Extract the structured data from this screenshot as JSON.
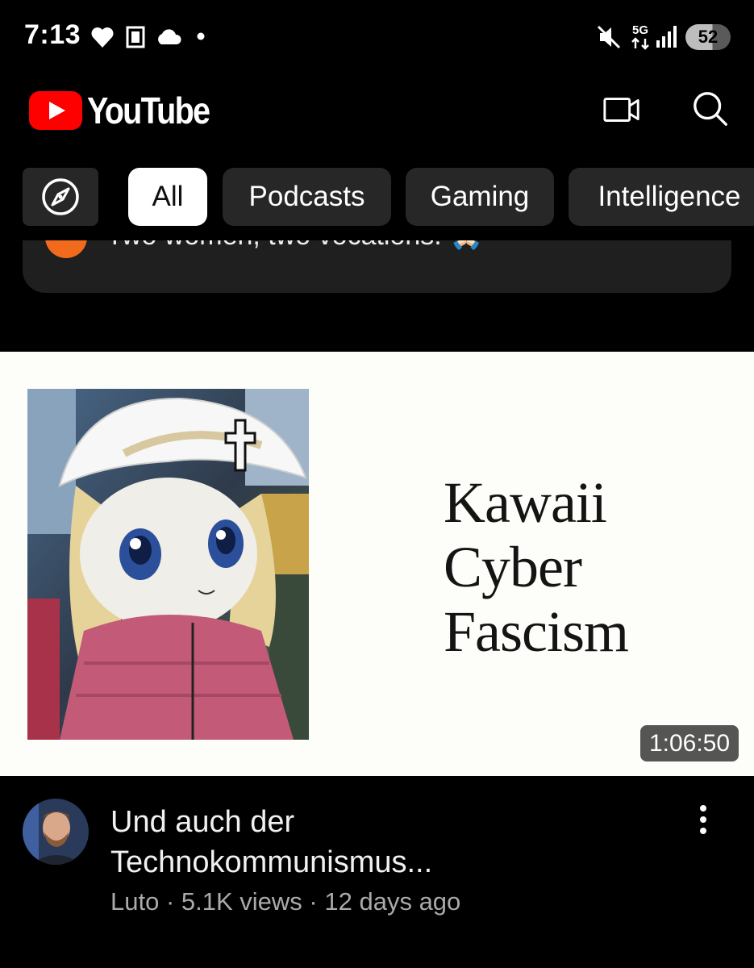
{
  "status_bar": {
    "time": "7:13",
    "left_icons": [
      "heart-icon",
      "kindle-notification-icon",
      "cloud-icon",
      "dot-icon"
    ],
    "right_icons": [
      "mute-icon",
      "5g-icon",
      "signal-icon"
    ],
    "network": "5G",
    "battery": "52"
  },
  "header": {
    "brand": "YouTube",
    "brand_color": "#ff0000",
    "actions": [
      "cast-icon",
      "search-icon"
    ]
  },
  "chips": {
    "explore_icon": "compass-icon",
    "items": [
      {
        "label": "All",
        "active": true
      },
      {
        "label": "Podcasts",
        "active": false
      },
      {
        "label": "Gaming",
        "active": false
      },
      {
        "label": "Intelligence",
        "active": false
      }
    ]
  },
  "previous_card": {
    "text": "Two women, two vocations. 🙏🏻"
  },
  "video": {
    "thumbnail_title_lines": [
      "Kawaii",
      "Cyber",
      "Fascism"
    ],
    "duration": "1:06:50",
    "title_lines": [
      "Und auch der",
      "Technokommunismus..."
    ],
    "channel": "Luto",
    "views": "5.1K views",
    "age": "12 days ago",
    "separator": " · "
  }
}
